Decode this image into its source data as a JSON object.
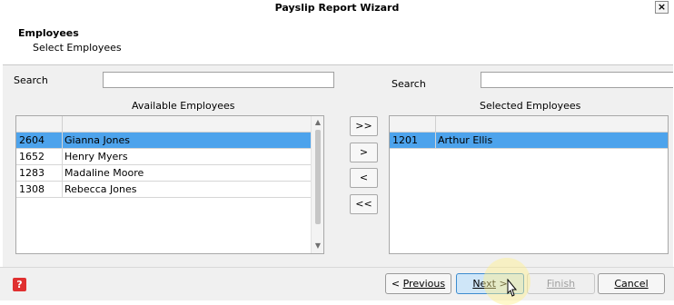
{
  "window": {
    "title": "Payslip Report Wizard",
    "close_glyph": "×"
  },
  "header": {
    "title": "Employees",
    "subtitle": "Select Employees"
  },
  "left": {
    "search_label": "Search",
    "search_value": "",
    "list_title": "Available Employees",
    "rows": [
      {
        "id": "2604",
        "name": "Gianna Jones",
        "selected": true
      },
      {
        "id": "1652",
        "name": "Henry Myers",
        "selected": false
      },
      {
        "id": "1283",
        "name": "Madaline Moore",
        "selected": false
      },
      {
        "id": "1308",
        "name": "Rebecca Jones",
        "selected": false
      }
    ]
  },
  "right": {
    "search_label": "Search",
    "search_value": "",
    "list_title": "Selected Employees",
    "rows": [
      {
        "id": "1201",
        "name": "Arthur Ellis",
        "selected": true
      }
    ]
  },
  "move_buttons": {
    "add_all": ">>",
    "add": ">",
    "remove": "<",
    "remove_all": "<<"
  },
  "footer": {
    "help_glyph": "?",
    "previous": {
      "prefix": "< ",
      "label": "Previous"
    },
    "next": {
      "label": "Next",
      "suffix": " >"
    },
    "finish": {
      "label": "Finish"
    },
    "cancel": {
      "label": "Cancel"
    }
  },
  "colors": {
    "selection": "#4da3ec",
    "help": "#e03030"
  }
}
